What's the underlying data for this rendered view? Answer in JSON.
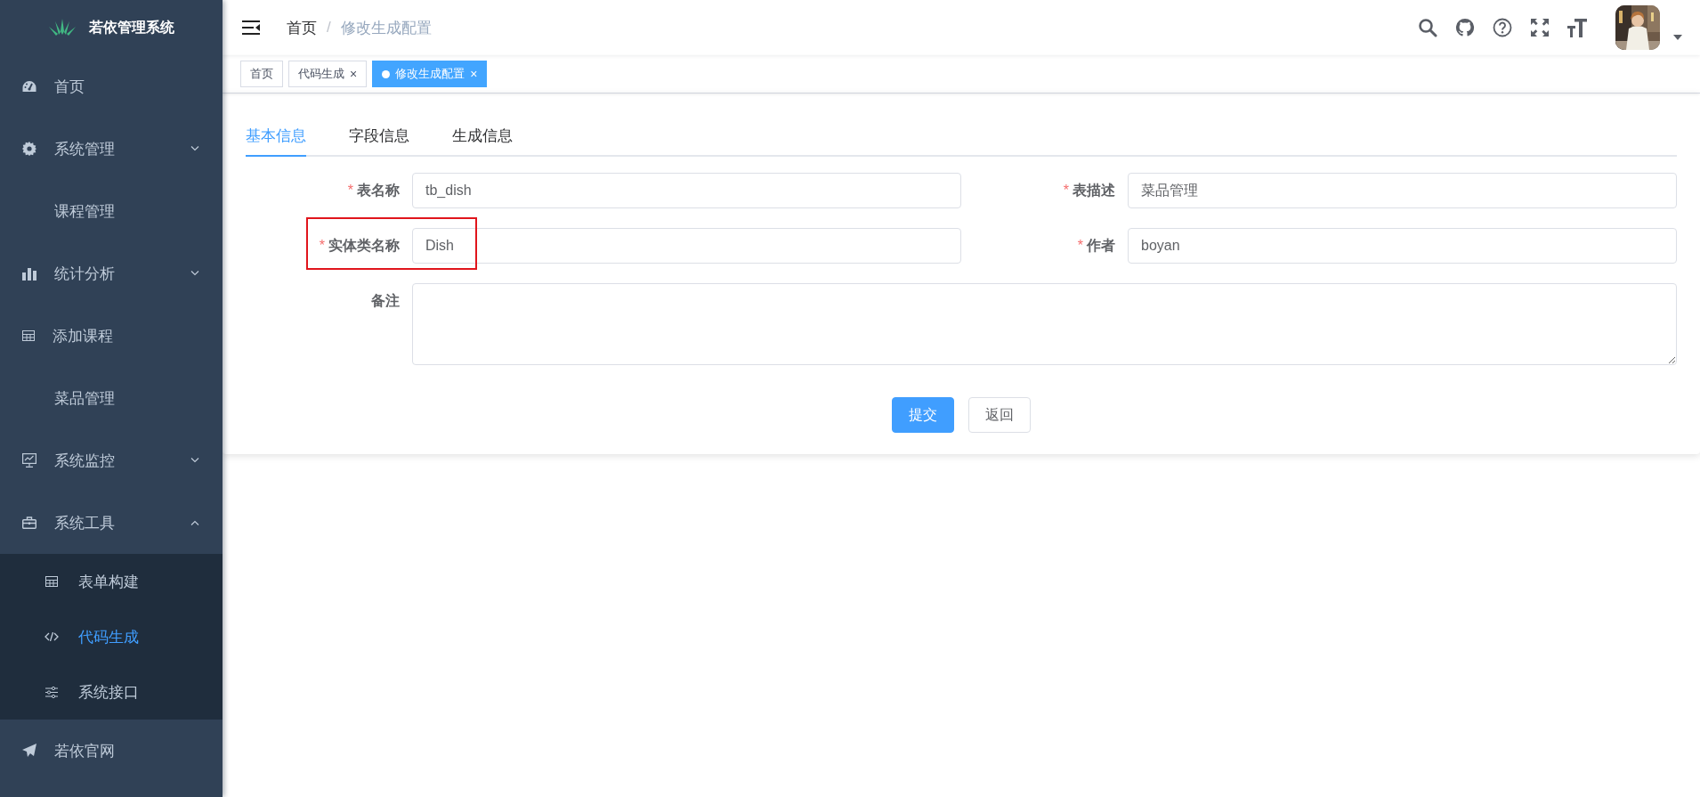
{
  "sidebar": {
    "title": "若依管理系统",
    "items": [
      {
        "label": "首页",
        "selected": false
      },
      {
        "label": "系统管理",
        "selected": false,
        "expanded": false
      },
      {
        "label": "课程管理",
        "selected": false
      },
      {
        "label": "统计分析",
        "selected": false,
        "expanded": false
      },
      {
        "label": "添加课程",
        "selected": false
      },
      {
        "label": "菜品管理",
        "selected": false
      },
      {
        "label": "系统监控",
        "selected": false,
        "expanded": false
      },
      {
        "label": "系统工具",
        "selected": false,
        "expanded": true,
        "children": [
          {
            "label": "表单构建",
            "selected": false
          },
          {
            "label": "代码生成",
            "selected": true
          },
          {
            "label": "系统接口",
            "selected": false
          }
        ]
      },
      {
        "label": "若依官网",
        "selected": false
      }
    ]
  },
  "breadcrumb": [
    {
      "label": "首页"
    },
    {
      "label": "/"
    },
    {
      "label": "修改生成配置"
    }
  ],
  "tags": [
    {
      "label": "首页",
      "selected": false
    },
    {
      "label": "代码生成",
      "selected": false,
      "close": "×"
    },
    {
      "label": "修改生成配置",
      "selected": true,
      "close": "×"
    }
  ],
  "form_tabs": [
    {
      "label": "基本信息",
      "selected": true
    },
    {
      "label": "字段信息",
      "selected": false
    },
    {
      "label": "生成信息",
      "selected": false
    }
  ],
  "fields": [
    {
      "kind": "input",
      "label": "表名称",
      "required_mark": "*",
      "value": "tb_dish",
      "highlighted": false
    },
    {
      "kind": "input",
      "label": "表描述",
      "required_mark": "*",
      "value": "菜品管理",
      "highlighted": false
    },
    {
      "kind": "input",
      "label": "实体类名称",
      "required_mark": "*",
      "value": "Dish",
      "highlighted": true
    },
    {
      "kind": "input",
      "label": "作者",
      "required_mark": "*",
      "value": "boyan",
      "highlighted": false
    },
    {
      "kind": "textarea",
      "label": "备注",
      "highlighted": false
    }
  ],
  "buttons": [
    {
      "label": "提交",
      "kind": "primary"
    },
    {
      "label": "返回",
      "kind": "plain"
    }
  ]
}
